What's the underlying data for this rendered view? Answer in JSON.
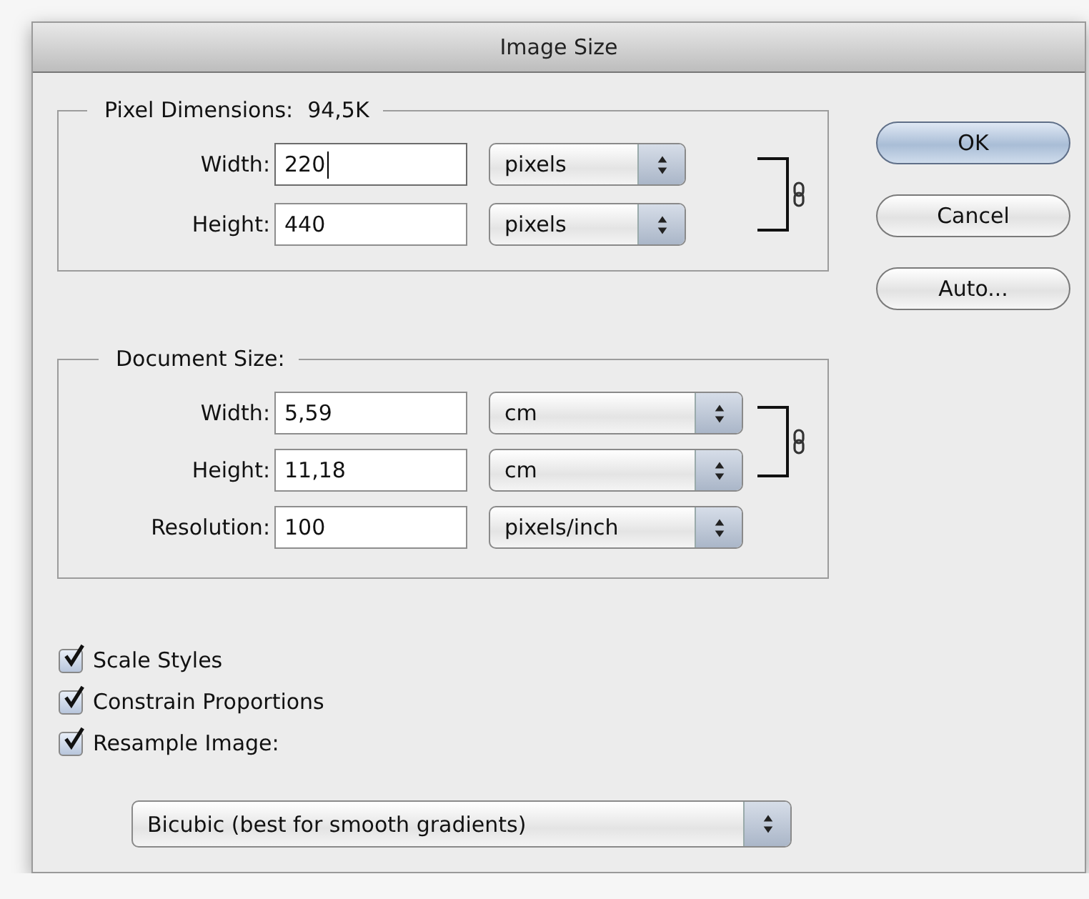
{
  "window": {
    "title": "Image Size"
  },
  "groups": [
    {
      "title": "Pixel Dimensions:",
      "value": "94,5K",
      "rows": [
        {
          "label": "Width:",
          "value": "220",
          "focused": true,
          "unit": "pixels",
          "linked": true
        },
        {
          "label": "Height:",
          "value": "440",
          "focused": false,
          "unit": "pixels",
          "linked": true
        }
      ]
    },
    {
      "title": "Document Size:",
      "rows": [
        {
          "label": "Width:",
          "value": "5,59",
          "focused": false,
          "unit": "cm",
          "linked": true
        },
        {
          "label": "Height:",
          "value": "11,18",
          "focused": false,
          "unit": "cm",
          "linked": true
        },
        {
          "label": "Resolution:",
          "value": "100",
          "focused": false,
          "unit": "pixels/inch",
          "linked": false
        }
      ]
    }
  ],
  "buttons": [
    {
      "label": "OK",
      "default": true
    },
    {
      "label": "Cancel",
      "default": false
    },
    {
      "label": "Auto...",
      "default": false
    }
  ],
  "checkboxes": [
    {
      "label": "Scale Styles",
      "checked": true
    },
    {
      "label": "Constrain Proportions",
      "checked": true
    },
    {
      "label": "Resample Image:",
      "checked": true
    }
  ],
  "resample_method": "Bicubic (best for smooth gradients)"
}
